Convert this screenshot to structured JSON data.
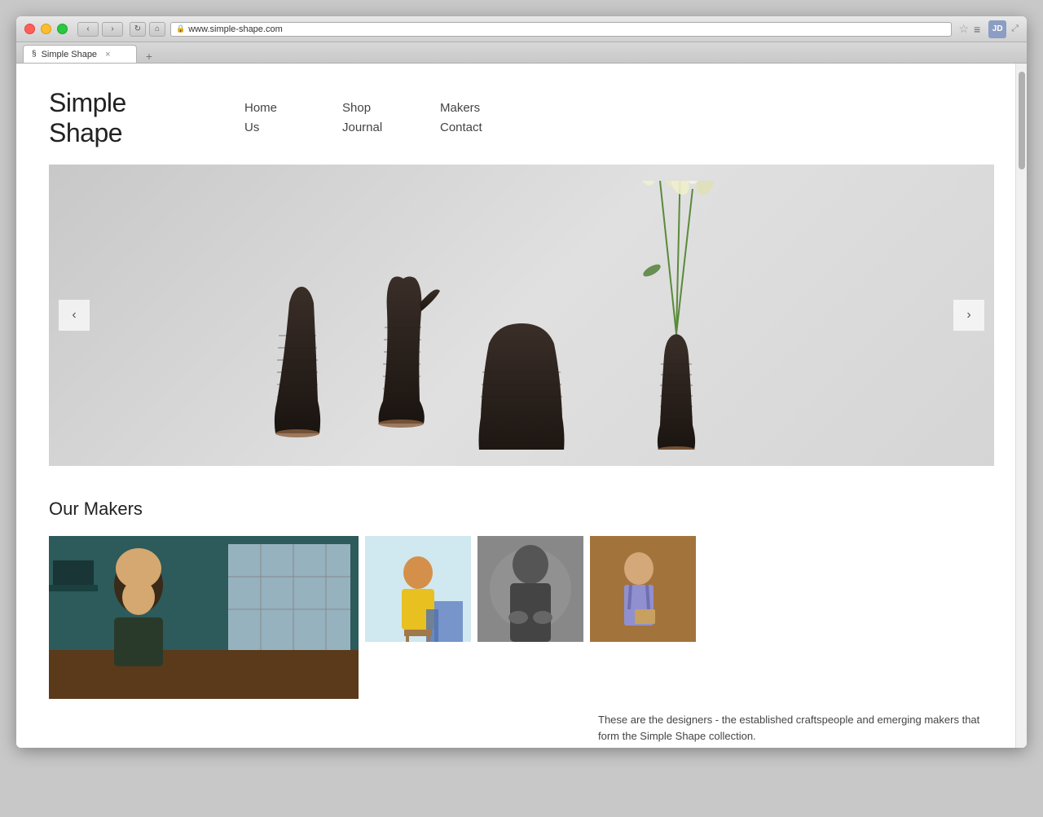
{
  "browser": {
    "url": "www.simple-shape.com",
    "tab_title": "Simple Shape",
    "tab_favicon": "§",
    "user_initials": "JD",
    "traffic_lights": {
      "red": "close",
      "yellow": "minimize",
      "green": "maximize"
    }
  },
  "site": {
    "logo_line1": "Simple",
    "logo_line2": "Shape",
    "nav": {
      "col1": [
        "Home",
        "Us"
      ],
      "col2": [
        "Shop",
        "Journal"
      ],
      "col3": [
        "Makers",
        "Contact"
      ]
    },
    "hero": {
      "prev_label": "‹",
      "next_label": "›"
    },
    "makers": {
      "section_title": "Our Makers",
      "description": "These are the designers - the established craftspeople and emerging makers that form the Simple Shape collection."
    }
  }
}
